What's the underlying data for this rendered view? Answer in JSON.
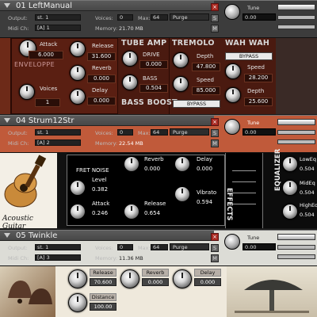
{
  "instruments": [
    {
      "name": "01 LeftManual",
      "output": "st. 1",
      "midi": "[A]  1",
      "voices": "0",
      "max": "64",
      "memory": "21.70 MB",
      "purge": "Purge",
      "tune_label": "Tune",
      "tune_value": "0.00"
    },
    {
      "name": "04 Strum12Str",
      "output": "st. 1",
      "midi": "[A]  2",
      "voices": "0",
      "max": "64",
      "memory": "22.54 MB",
      "purge": "Purge",
      "tune_label": "Tune",
      "tune_value": "0.00"
    },
    {
      "name": "05 Twinkle",
      "output": "st. 1",
      "midi": "[A]  3",
      "voices": "0",
      "max": "64",
      "memory": "11.36 MB",
      "purge": "Purge",
      "tune_label": "Tune",
      "tune_value": "0.00"
    }
  ],
  "labels": {
    "output": "Output:",
    "midi": "Midi Ch:",
    "voices": "Voices:",
    "max": "Max:",
    "memory": "Memory:",
    "s": "S",
    "m": "M",
    "close": "×"
  },
  "manual": {
    "attack_label": "Attack",
    "attack_value": "6.000",
    "envelope_label": "ENVELOPPE",
    "voices_label": "Voices",
    "voices_value": "1",
    "release_label": "Release",
    "release_value": "31.600",
    "reverb_label": "Reverb",
    "reverb_value": "0.000",
    "delay_label": "Delay",
    "delay_value": "0.000",
    "tube_amp": "TUBE AMP",
    "drive_label": "DRIVE",
    "drive_value": "0.000",
    "bass_label": "BASS",
    "bass_value": "0.504",
    "bass_boost": "BASS BOOST",
    "bass_boost_bypass": "BYPASS",
    "tremolo": "TREMOLO",
    "trem_depth_label": "Depth",
    "trem_depth_value": "47.800",
    "trem_speed_label": "Speed",
    "trem_speed_value": "85.000",
    "wahwah": "WAH WAH",
    "wah_bypass": "BYPASS",
    "wah_speed_label": "Speed",
    "wah_speed_value": "28.200",
    "wah_depth_label": "Depth",
    "wah_depth_value": "25.600"
  },
  "strum": {
    "logo_text": "Acoustic Guitar",
    "fretnoise_label": "FRET NOISE",
    "level_label": "Level",
    "level_value": "0.382",
    "attack_label": "Attack",
    "attack_value": "0.246",
    "reverb_label": "Reverb",
    "reverb_value": "0.000",
    "release_label": "Release",
    "release_value": "0.654",
    "delay_label": "Delay",
    "delay_value": "0.000",
    "vibrato_label": "Vibrato",
    "vibrato_value": "0.594",
    "effects_label": "EFFECTS",
    "equalizer_label": "EQUALIZER",
    "loweq_label": "LowEq",
    "loweq_value": "0.504",
    "mideq_label": "MidEq",
    "mideq_value": "0.504",
    "higheq_label": "HighEq",
    "higheq_value": "0.504"
  },
  "twinkle": {
    "release_label": "Release",
    "release_value": "70.600",
    "reverb_label": "Reverb",
    "reverb_value": "0.000",
    "delay_label": "Delay",
    "delay_value": "0.000",
    "distance_label": "Distance",
    "distance_value": "100.00"
  }
}
